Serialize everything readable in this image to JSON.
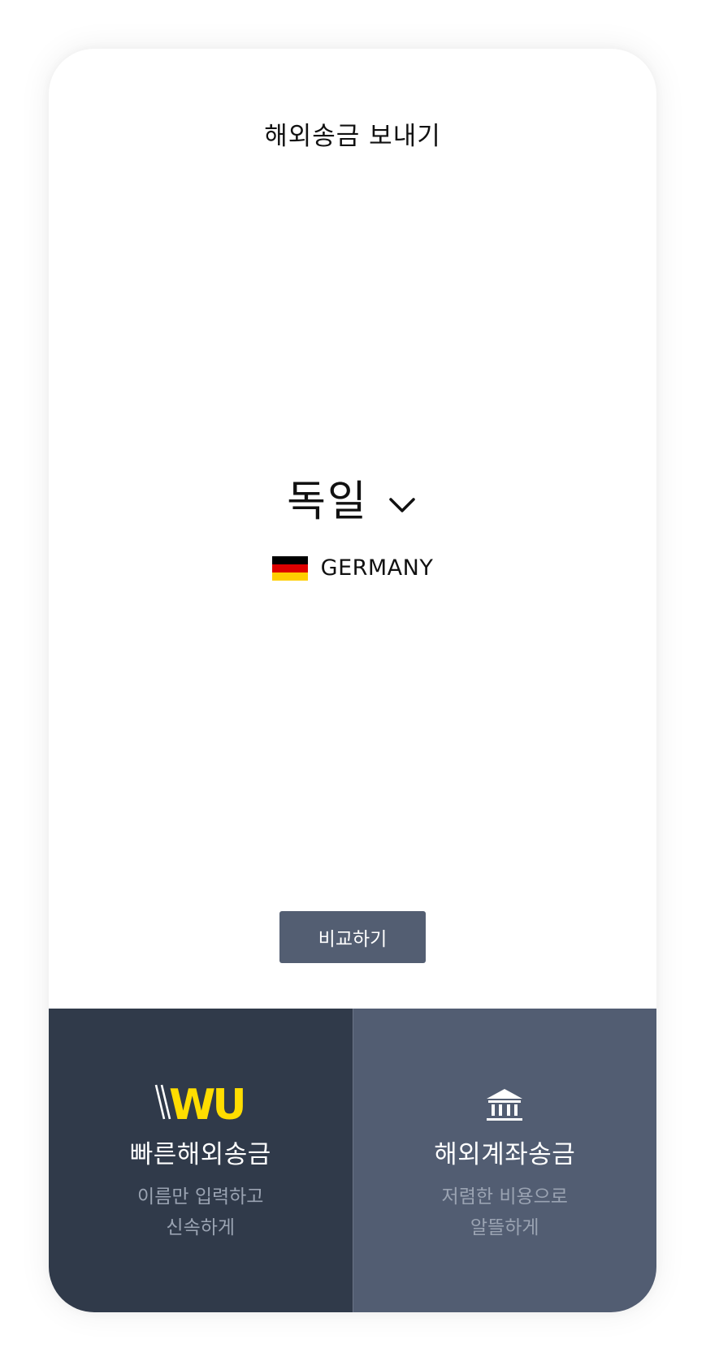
{
  "header": {
    "title": "해외송금 보내기"
  },
  "country": {
    "name_ko": "독일",
    "name_en": "GERMANY",
    "flag_colors": [
      "#000000",
      "#dd0000",
      "#ffce00"
    ]
  },
  "compare_button": {
    "label": "비교하기"
  },
  "options": [
    {
      "icon": "wu-logo",
      "logo_text": "WU",
      "title": "빠른해외송금",
      "desc_line1": "이름만 입력하고",
      "desc_line2": "신속하게"
    },
    {
      "icon": "bank-icon",
      "title": "해외계좌송금",
      "desc_line1": "저렴한 비용으로",
      "desc_line2": "알뜰하게"
    }
  ],
  "colors": {
    "button_bg": "#535e72",
    "left_panel_bg": "#303a4a",
    "right_panel_bg": "#525d72",
    "wu_yellow": "#ffdd00",
    "desc_text": "#9aa3b2"
  }
}
